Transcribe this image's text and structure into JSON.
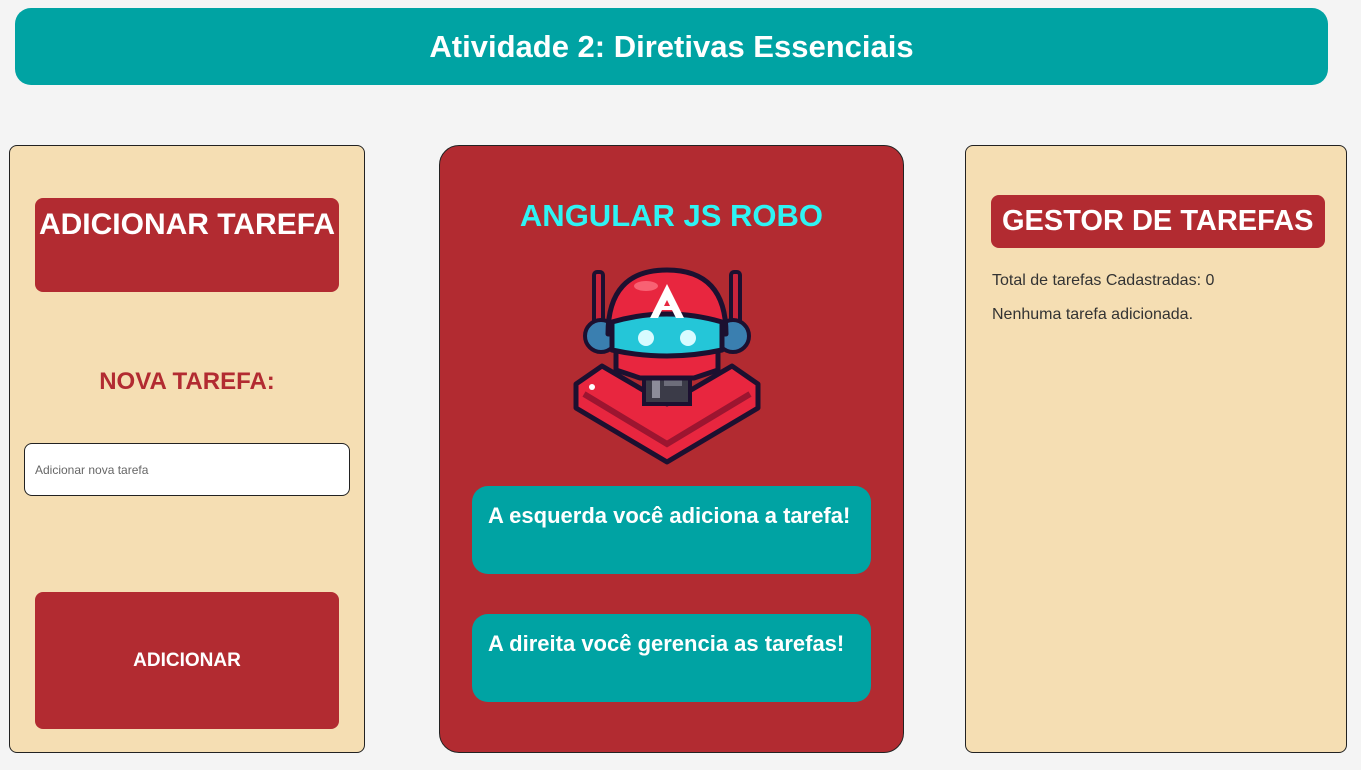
{
  "header": {
    "title": "Atividade 2: Diretivas Essenciais"
  },
  "left_panel": {
    "title": "ADICIONAR TAREFA",
    "label": "NOVA TAREFA:",
    "input": {
      "placeholder": "Adicionar nova tarefa",
      "value": ""
    },
    "button_label": "ADICIONAR"
  },
  "center_panel": {
    "title": "ANGULAR JS ROBO",
    "robot_icon": "robot-mascot-icon",
    "message_1": "A esquerda você adiciona a tarefa!",
    "message_2": "A direita você gerencia as tarefas!"
  },
  "right_panel": {
    "title": "GESTOR DE TAREFAS",
    "total_label": "Total de tarefas Cadastradas: 0",
    "empty_message": "Nenhuma tarefa adicionada."
  },
  "colors": {
    "teal": "#00a3a3",
    "crimson": "#b22b31",
    "wheat": "#f5deb3",
    "cyan_title": "#2ff3f3"
  }
}
